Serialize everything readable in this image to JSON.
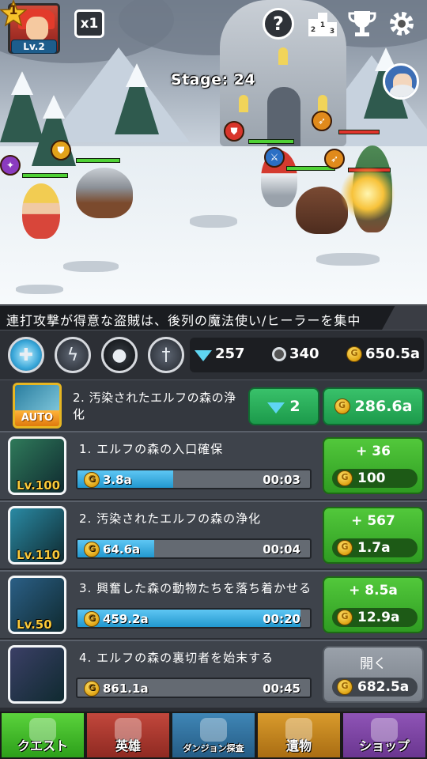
{
  "player": {
    "rank": "1",
    "level": "Lv.2"
  },
  "top_bar": {
    "speed_label": "x1",
    "help_label": "?"
  },
  "stage": {
    "label": "Stage: 24"
  },
  "ticker": {
    "text": "連打攻撃が得意な盗賊は、後列の魔法使い/ヒーラーを集中"
  },
  "resources": {
    "gems": "257",
    "stopwatch": "340",
    "gold": "650.5a"
  },
  "auto_quest": {
    "badge": "AUTO",
    "title": "2. 汚染されたエルフの森の浄化",
    "gem_cost": "2",
    "gold_cost": "286.6a"
  },
  "quests": [
    {
      "title": "1. エルフの森の入口確保",
      "level": "Lv.100",
      "reward": "3.8a",
      "time": "00:03",
      "progress": 0.41,
      "gain": "+ 36",
      "cost": "100",
      "thumb_color": "#2f7a5a"
    },
    {
      "title": "2. 汚染されたエルフの森の浄化",
      "level": "Lv.110",
      "reward": "64.6a",
      "time": "00:04",
      "progress": 0.33,
      "gain": "+ 567",
      "cost": "1.7a",
      "thumb_color": "#2a8aa4"
    },
    {
      "title": "3. 興奮した森の動物たちを落ち着かせる",
      "level": "Lv.50",
      "reward": "459.2a",
      "time": "00:20",
      "progress": 0.96,
      "gain": "+ 8.5a",
      "cost": "12.9a",
      "thumb_color": "#2b5f86"
    },
    {
      "title": "4. エルフの森の裏切者を始末する",
      "level": "",
      "reward": "861.1a",
      "time": "00:45",
      "progress": 0,
      "gain": "開く",
      "cost": "682.5a",
      "thumb_color": "#3b3f66"
    }
  ],
  "nav": {
    "quest": "クエスト",
    "hero": "英雄",
    "dungeon": "ダンジョン探査",
    "relic": "遺物",
    "shop": "ショップ"
  },
  "colors": {
    "accent_green": "#52c83b",
    "gold": "#f9c93a",
    "panel": "#3e434b"
  }
}
